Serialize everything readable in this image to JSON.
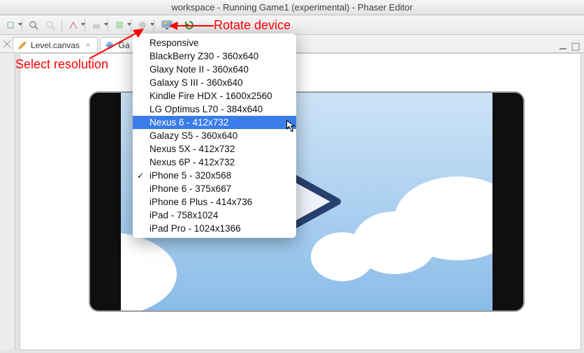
{
  "window": {
    "title": "workspace - Running Game1 (experimental) - Phaser Editor"
  },
  "tabs": {
    "file1_label": "Level.canvas",
    "file2_label": "Ga"
  },
  "annotations": {
    "rotate": "Rotate device",
    "select": "Select resolution"
  },
  "dropdown": {
    "items": [
      {
        "label": "Responsive"
      },
      {
        "label": "BlackBerry Z30 - 360x640"
      },
      {
        "label": "Glaxy Note II - 360x640"
      },
      {
        "label": "Galaxy S III - 360x640"
      },
      {
        "label": "Kindle Fire HDX - 1600x2560"
      },
      {
        "label": "LG Optimus L70 - 384x640"
      },
      {
        "label": "Nexus 6 - 412x732",
        "selected": true
      },
      {
        "label": "Galazy S5 - 360x640"
      },
      {
        "label": "Nexus 5X - 412x732"
      },
      {
        "label": "Nexus 6P - 412x732"
      },
      {
        "label": "iPhone 5 - 320x568",
        "checked": true
      },
      {
        "label": "iPhone 6 - 375x667"
      },
      {
        "label": "iPhone 6 Plus - 414x736"
      },
      {
        "label": "iPad - 758x1024"
      },
      {
        "label": "iPad Pro - 1024x1366"
      }
    ]
  }
}
